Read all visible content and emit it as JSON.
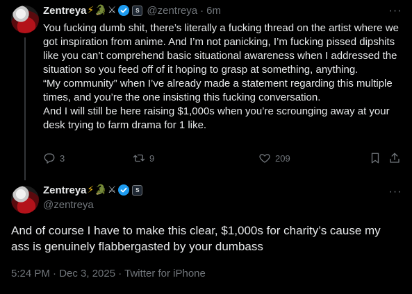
{
  "tweets": [
    {
      "author": {
        "display_name": "Zentreya",
        "name_emojis": [
          "⚡",
          "🐊",
          "⚔"
        ],
        "verified": true,
        "affiliate_badge": "S",
        "handle": "@zentreya"
      },
      "separator": "·",
      "time": "6m",
      "more_label": "···",
      "paragraphs": [
        "You fucking dumb shit, there’s literally a fucking thread on the artist where we got inspiration from anime. And I’m not panicking, I’m fucking pissed dipshits like you can’t comprehend basic situational awareness when I addressed the situation so you feed off of it hoping to grasp at something, anything.",
        "“My community” when I’ve already made a statement regarding this multiple times, and you’re the one insisting this fucking conversation.",
        "And I will still be here raising $1,000s when you’re scrounging away at your desk trying to farm drama for 1 like."
      ],
      "actions": {
        "replies": "3",
        "retweets": "9",
        "likes": "209"
      },
      "icons": {
        "reply": "reply-icon",
        "retweet": "retweet-icon",
        "like": "heart-icon",
        "bookmark": "bookmark-icon",
        "share": "share-icon"
      }
    },
    {
      "author": {
        "display_name": "Zentreya",
        "name_emojis": [
          "⚡",
          "🐊",
          "⚔"
        ],
        "verified": true,
        "affiliate_badge": "S",
        "handle": "@zentreya"
      },
      "more_label": "···",
      "text": "And of course I have to make this clear, $1,000s for charity’s cause my ass is genuinely flabbergasted by your dumbass",
      "meta": "5:24 PM · Dec 3, 2025 · Twitter for iPhone"
    }
  ],
  "colors": {
    "background": "#000000",
    "text_primary": "#e7e9ea",
    "text_secondary": "#71767b",
    "verified_blue": "#1d9bf0",
    "thread_line": "#333639"
  }
}
